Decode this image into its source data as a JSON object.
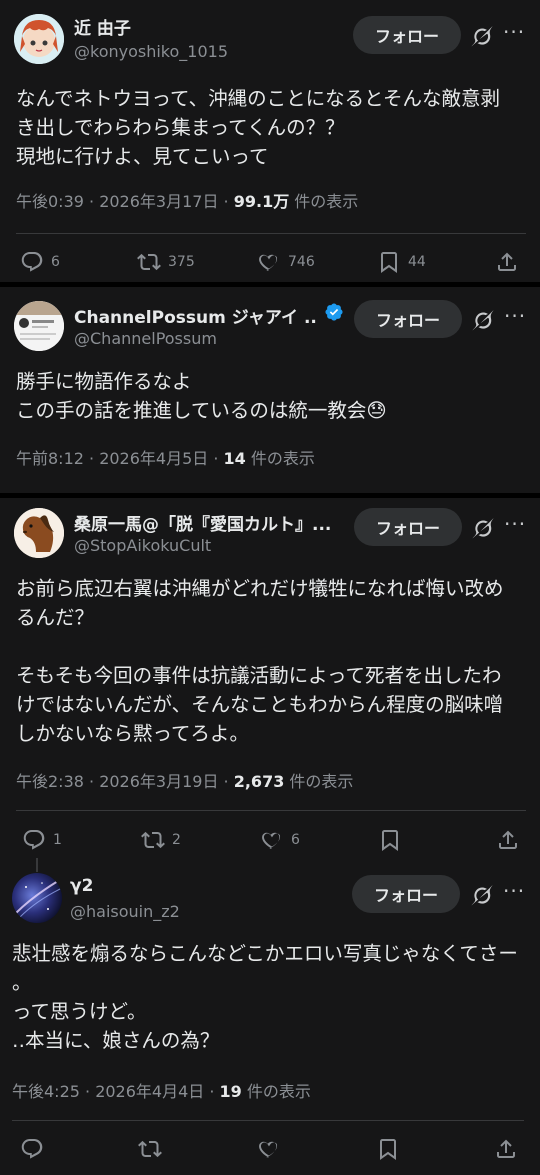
{
  "posts": [
    {
      "name": "近 由子",
      "handle": "@konyoshiko_1015",
      "follow_label": "フォロー",
      "body_lines": [
        "なんでネトウヨって、沖縄のことになるとそんな敵意剥",
        "き出しでわらわら集まってくんの？？",
        "現地に行けよ、見てこいって"
      ],
      "time": "午後0:39 · 2026年3月17日 · ",
      "views": "99.1万",
      "views_suffix": " 件の表示",
      "replies": "6",
      "reposts": "375",
      "likes": "746",
      "bookmarks": "44"
    },
    {
      "name": "ChannelPossum ジャアイ ...",
      "handle": "@ChannelPossum",
      "follow_label": "フォロー",
      "body_lines": [
        "勝手に物語作るなよ",
        "この手の話を推進しているのは統一教会"
      ],
      "emoji": "😓",
      "time": "午前8:12 · 2026年4月5日 · ",
      "views": "14",
      "views_suffix": " 件の表示"
    },
    {
      "name": "桑原一馬@「脱『愛国カルト』...",
      "handle": "@StopAikokuCult",
      "follow_label": "フォロー",
      "body_lines": [
        "お前ら底辺右翼は沖縄がどれだけ犠牲になれば悔い改め",
        "るんだ？",
        "",
        "そもそも今回の事件は抗議活動によって死者を出したわ",
        "けではないんだが、そんなこともわからん程度の脳味噌",
        "しかないなら黙ってろよ。"
      ],
      "time": "午後2:38 · 2026年3月19日 · ",
      "views": "2,673",
      "views_suffix": " 件の表示",
      "replies": "1",
      "reposts": "2",
      "likes": "6"
    },
    {
      "name": "γ2",
      "handle": "@haisouin_z2",
      "follow_label": "フォロー",
      "body_lines": [
        "悲壮感を煽るならこんなどこかエロい写真じゃなくてさー",
        "。",
        "って思うけど。",
        "‥本当に、娘さんの為？"
      ],
      "time": "午後4:25 · 2026年4月4日 · ",
      "views": "19",
      "views_suffix": " 件の表示"
    }
  ],
  "icons": {
    "reply": "reply-icon",
    "repost": "repost-icon",
    "like": "heart-icon",
    "bookmark": "bookmark-icon",
    "share": "share-icon",
    "grok": "grok-icon",
    "more": "more-icon",
    "verified": "verified-badge-icon"
  },
  "colors": {
    "background": "#161617",
    "text": "#e7e9ea",
    "muted": "#8b8f94",
    "verified": "#1d9bf0",
    "follow_bg": "#2f3133"
  }
}
